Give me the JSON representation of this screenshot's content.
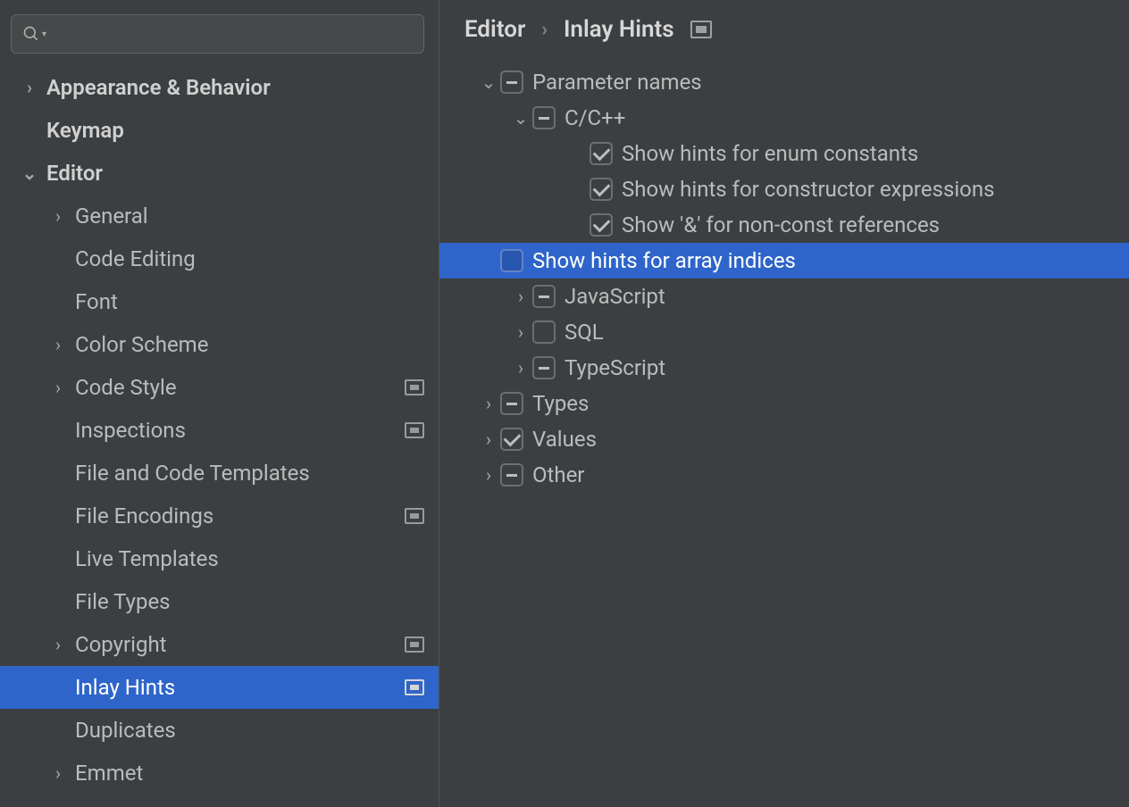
{
  "search": {
    "placeholder": ""
  },
  "breadcrumb": {
    "parent": "Editor",
    "current": "Inlay Hints"
  },
  "sidebar": [
    {
      "label": "Appearance & Behavior",
      "level": 0,
      "chevron": "right",
      "bold": true,
      "proj": false,
      "selected": false
    },
    {
      "label": "Keymap",
      "level": 0,
      "chevron": "",
      "bold": true,
      "proj": false,
      "selected": false
    },
    {
      "label": "Editor",
      "level": 0,
      "chevron": "down",
      "bold": true,
      "proj": false,
      "selected": false
    },
    {
      "label": "General",
      "level": 1,
      "chevron": "right",
      "bold": false,
      "proj": false,
      "selected": false
    },
    {
      "label": "Code Editing",
      "level": 1,
      "chevron": "",
      "bold": false,
      "proj": false,
      "selected": false
    },
    {
      "label": "Font",
      "level": 1,
      "chevron": "",
      "bold": false,
      "proj": false,
      "selected": false
    },
    {
      "label": "Color Scheme",
      "level": 1,
      "chevron": "right",
      "bold": false,
      "proj": false,
      "selected": false
    },
    {
      "label": "Code Style",
      "level": 1,
      "chevron": "right",
      "bold": false,
      "proj": true,
      "selected": false
    },
    {
      "label": "Inspections",
      "level": 1,
      "chevron": "",
      "bold": false,
      "proj": true,
      "selected": false
    },
    {
      "label": "File and Code Templates",
      "level": 1,
      "chevron": "",
      "bold": false,
      "proj": false,
      "selected": false
    },
    {
      "label": "File Encodings",
      "level": 1,
      "chevron": "",
      "bold": false,
      "proj": true,
      "selected": false
    },
    {
      "label": "Live Templates",
      "level": 1,
      "chevron": "",
      "bold": false,
      "proj": false,
      "selected": false
    },
    {
      "label": "File Types",
      "level": 1,
      "chevron": "",
      "bold": false,
      "proj": false,
      "selected": false
    },
    {
      "label": "Copyright",
      "level": 1,
      "chevron": "right",
      "bold": false,
      "proj": true,
      "selected": false
    },
    {
      "label": "Inlay Hints",
      "level": 1,
      "chevron": "",
      "bold": false,
      "proj": true,
      "selected": true
    },
    {
      "label": "Duplicates",
      "level": 1,
      "chevron": "",
      "bold": false,
      "proj": false,
      "selected": false
    },
    {
      "label": "Emmet",
      "level": 1,
      "chevron": "right",
      "bold": false,
      "proj": false,
      "selected": false
    }
  ],
  "tree": [
    {
      "label": "Parameter names",
      "level": 0,
      "chevron": "down",
      "cb": "indet",
      "selected": false
    },
    {
      "label": "C/C++",
      "level": 1,
      "chevron": "down",
      "cb": "indet",
      "selected": false
    },
    {
      "label": "Show hints for enum constants",
      "level": 2,
      "chevron": "",
      "cb": "checked",
      "selected": false
    },
    {
      "label": "Show hints for constructor expressions",
      "level": 2,
      "chevron": "",
      "cb": "checked",
      "selected": false
    },
    {
      "label": "Show '&' for non-const references",
      "level": 2,
      "chevron": "",
      "cb": "checked",
      "selected": false
    },
    {
      "label": "Show hints for array indices",
      "level": 2,
      "chevron": "",
      "cb": "empty",
      "selected": true
    },
    {
      "label": "JavaScript",
      "level": 1,
      "chevron": "right",
      "cb": "indet",
      "selected": false
    },
    {
      "label": "SQL",
      "level": 1,
      "chevron": "right",
      "cb": "empty",
      "selected": false
    },
    {
      "label": "TypeScript",
      "level": 1,
      "chevron": "right",
      "cb": "indet",
      "selected": false
    },
    {
      "label": "Types",
      "level": 0,
      "chevron": "right",
      "cb": "indet",
      "selected": false
    },
    {
      "label": "Values",
      "level": 0,
      "chevron": "right",
      "cb": "checked",
      "selected": false
    },
    {
      "label": "Other",
      "level": 0,
      "chevron": "right",
      "cb": "indet",
      "selected": false
    }
  ]
}
